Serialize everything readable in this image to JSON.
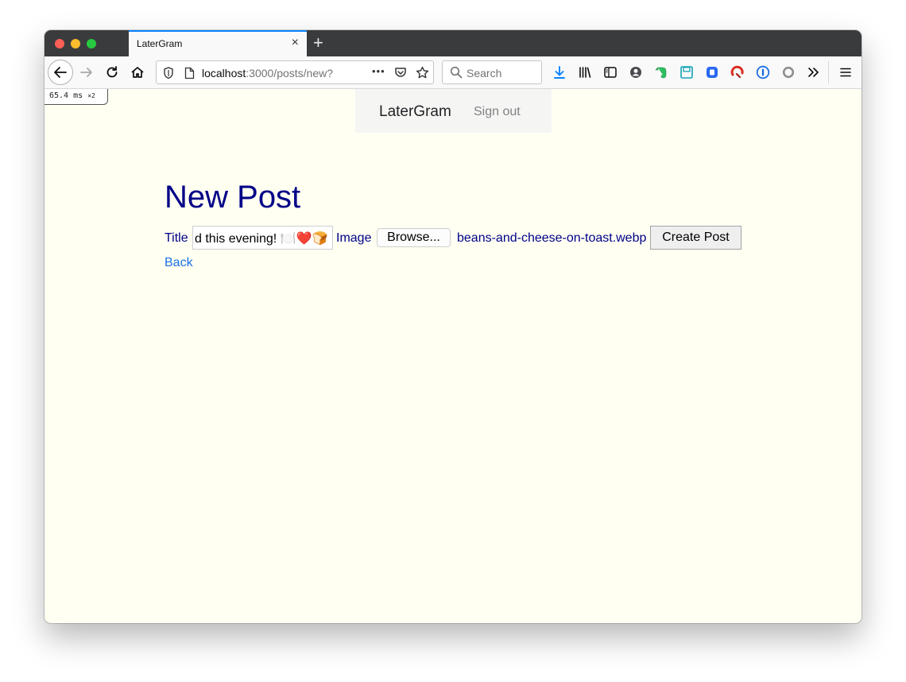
{
  "browser": {
    "tab_title": "LaterGram",
    "tab_close": "×",
    "new_tab": "+",
    "url_host": "localhost",
    "url_path": ":3000/posts/new?",
    "url_more": "•••",
    "search_placeholder": "Search",
    "perf_ms": "65.4",
    "perf_unit": "ms",
    "perf_mult": "×2"
  },
  "nav": {
    "brand": "LaterGram",
    "sign_out": "Sign out"
  },
  "page": {
    "heading": "New Post",
    "title_label": "Title",
    "title_value": "d this evening! 🍽️❤️🍞",
    "image_label": "Image",
    "browse_label": "Browse...",
    "file_name": "beans-and-cheese-on-toast.webp",
    "submit_label": "Create Post",
    "back_label": "Back"
  },
  "colors": {
    "page_bg": "#fffff2",
    "heading": "#000088",
    "link": "#1a73e8",
    "tab_accent": "#0a84ff"
  }
}
